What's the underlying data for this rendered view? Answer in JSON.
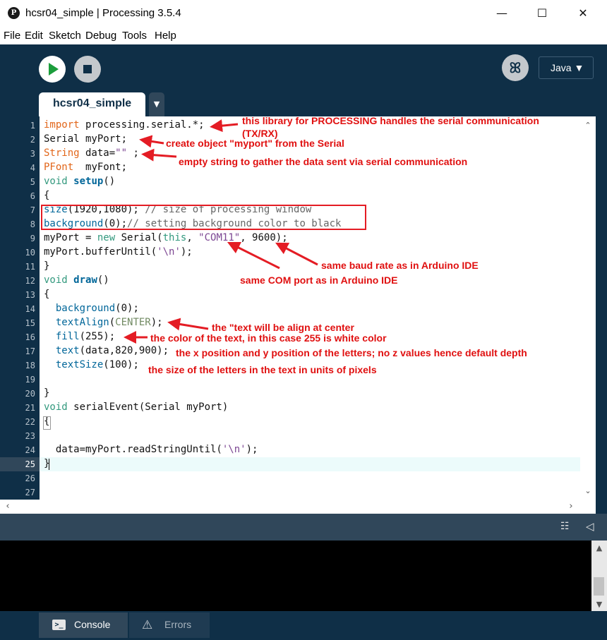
{
  "window": {
    "title": "hcsr04_simple | Processing 3.5.4",
    "app_icon": "P"
  },
  "menu": [
    "File",
    "Edit",
    "Sketch",
    "Debug",
    "Tools",
    "Help"
  ],
  "toolbar": {
    "mode_label": "Java ▼",
    "debug_glyph": "ꕤ"
  },
  "tabs": {
    "active": "hcsr04_simple",
    "menu_glyph": "▼"
  },
  "line_numbers": [
    "1",
    "2",
    "3",
    "4",
    "5",
    "6",
    "7",
    "8",
    "9",
    "10",
    "11",
    "12",
    "13",
    "14",
    "15",
    "16",
    "17",
    "18",
    "19",
    "20",
    "21",
    "22",
    "23",
    "24",
    "25",
    "26",
    "27"
  ],
  "code": {
    "l1a": "import",
    "l1b": " processing.serial.*;",
    "l2": "Serial myPort;",
    "l3a": "String",
    "l3b": " data=",
    "l3c": "\"\"",
    "l3d": " ;",
    "l4a": "PFont",
    "l4b": "  myFont;",
    "l5a": "void",
    "l5b": " ",
    "l5c": "setup",
    "l5d": "()",
    "l6": "{",
    "l7a": "size",
    "l7b": "(1920,1080); ",
    "l7c": "// size of processing window",
    "l8a": "background",
    "l8b": "(0);",
    "l8c": "// setting background color to black",
    "l9a": "myPort = ",
    "l9b": "new",
    "l9c": " Serial(",
    "l9d": "this",
    "l9e": ", ",
    "l9f": "\"COM11\"",
    "l9g": ", 9600);",
    "l10a": "myPort.bufferUntil(",
    "l10b": "'\\n'",
    "l10c": ");",
    "l11": "}",
    "l12a": "void",
    "l12b": " ",
    "l12c": "draw",
    "l12d": "()",
    "l13": "{",
    "l14a": "  ",
    "l14b": "background",
    "l14c": "(0);",
    "l15a": "  ",
    "l15b": "textAlign",
    "l15c": "(",
    "l15d": "CENTER",
    "l15e": ");",
    "l16a": "  ",
    "l16b": "fill",
    "l16c": "(255);",
    "l17a": "  ",
    "l17b": "text",
    "l17c": "(data,820,900);",
    "l18a": "  ",
    "l18b": "textSize",
    "l18c": "(100);",
    "l20": "}",
    "l21a": "void",
    "l21b": " serialEvent(Serial myPort)",
    "l22": "{",
    "l24a": "  data=myPort.readStringUntil(",
    "l24b": "'\\n'",
    "l24c": ");",
    "l25": "}"
  },
  "annotations": {
    "a1": "this library for PROCESSING handles the serial communication",
    "a1b": "(TX/RX)",
    "a2": "create object \"myport\" from the Serial",
    "a3": "empty string to gather the data sent via serial communication",
    "a4": "same baud rate as in Arduino IDE",
    "a5": "same COM port as in Arduino IDE",
    "a6": "the \"text will be align at center",
    "a7": "the color of the text, in this case 255 is white color",
    "a8": "the x position and y position of the letters; no z values hence default depth",
    "a9": "the size of the letters in the text in units of pixels"
  },
  "console_tabs": {
    "console": "Console",
    "errors": "Errors"
  },
  "colors": {
    "accent_dark": "#0f2f47",
    "annotation_red": "#e01010",
    "run_green": "#1c9d3c"
  }
}
